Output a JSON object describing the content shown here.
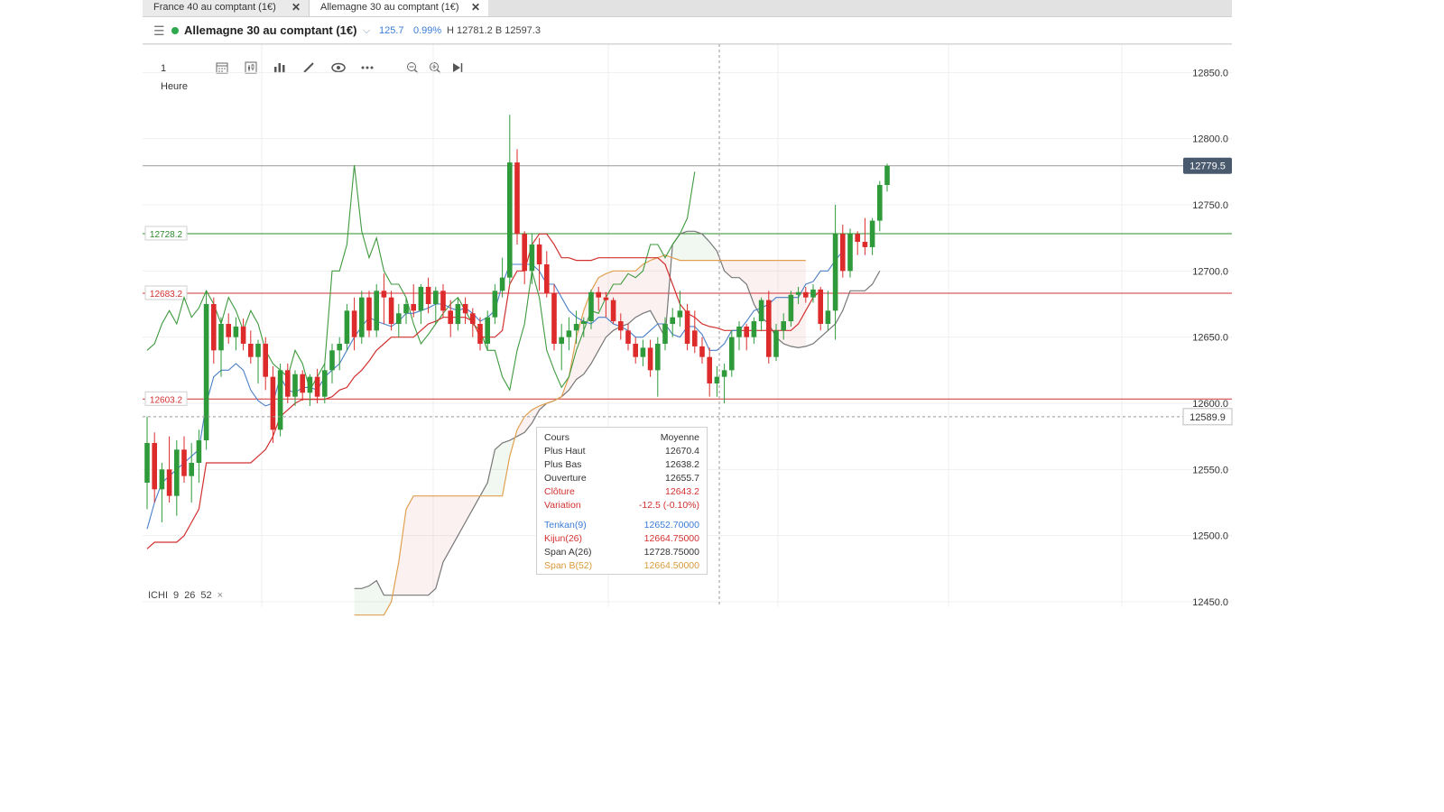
{
  "tabs": [
    {
      "label": "France 40 au comptant (1€)",
      "active": false
    },
    {
      "label": "Allemagne 30 au comptant (1€)",
      "active": true
    }
  ],
  "header": {
    "instrument": "Allemagne 30 au comptant (1€)",
    "change": "125.7",
    "change_pct": "0.99%",
    "high_low": "H 12781.2  B 12597.3",
    "status_color": "#2fa84f"
  },
  "toolbar": {
    "timeframe": "1 Heure",
    "icons": [
      "calendar-icon",
      "chart-type-icon",
      "indicators-icon",
      "draw-icon",
      "eye-icon",
      "more-icon",
      "zoom-out-icon",
      "zoom-in-icon",
      "play-end-icon"
    ]
  },
  "price_axis": {
    "ticks": [
      "12850.0",
      "12800.0",
      "12750.0",
      "12700.0",
      "12650.0",
      "12600.0",
      "12550.0",
      "12500.0",
      "12450.0"
    ],
    "current_price": "12779.5",
    "crosshair_price": "12589.9"
  },
  "levels": [
    {
      "label": "12728.2",
      "color": "#2e8b2e"
    },
    {
      "label": "12683.2",
      "color": "#d23030"
    },
    {
      "label": "12603.2",
      "color": "#d23030"
    }
  ],
  "tooltip": {
    "header_key": "Cours",
    "header_val": "Moyenne",
    "rows": [
      {
        "k": "Plus Haut",
        "v": "12670.4",
        "color": "#333333"
      },
      {
        "k": "Plus Bas",
        "v": "12638.2",
        "color": "#333333"
      },
      {
        "k": "Ouverture",
        "v": "12655.7",
        "color": "#333333"
      },
      {
        "k": "Clôture",
        "v": "12643.2",
        "color": "#d23030"
      },
      {
        "k": "Variation",
        "v": "-12.5 (-0.10%)",
        "color": "#d23030"
      }
    ],
    "ind_rows": [
      {
        "k": "Tenkan(9)",
        "v": "12652.70000",
        "color": "#3b7dd8"
      },
      {
        "k": "Kijun(26)",
        "v": "12664.75000",
        "color": "#d23030"
      },
      {
        "k": "Span A(26)",
        "v": "12728.75000",
        "color": "#333333"
      },
      {
        "k": "Span B(52)",
        "v": "12664.50000",
        "color": "#d99a3a"
      }
    ]
  },
  "indicator_label": {
    "name": "ICHI",
    "p1": "9",
    "p2": "26",
    "p3": "52",
    "close": "×"
  },
  "colors": {
    "up": "#2e9a3a",
    "down": "#dd2a2a",
    "tenkan": "#4a7fc8",
    "kijun": "#d23030",
    "chikou": "#3f9a3f",
    "spanA": "#777777",
    "spanB": "#e0a050"
  },
  "chart_data": {
    "type": "candlestick",
    "title": "Allemagne 30 au comptant (1€)",
    "interval": "1 Heure",
    "ylim": [
      12450,
      12860
    ],
    "grid": true,
    "candles": [
      {
        "o": 12540,
        "h": 12590,
        "l": 12520,
        "c": 12570
      },
      {
        "o": 12570,
        "h": 12578,
        "l": 12525,
        "c": 12535
      },
      {
        "o": 12535,
        "h": 12555,
        "l": 12510,
        "c": 12550
      },
      {
        "o": 12550,
        "h": 12575,
        "l": 12525,
        "c": 12530
      },
      {
        "o": 12530,
        "h": 12572,
        "l": 12515,
        "c": 12565
      },
      {
        "o": 12565,
        "h": 12575,
        "l": 12540,
        "c": 12545
      },
      {
        "o": 12545,
        "h": 12570,
        "l": 12525,
        "c": 12555
      },
      {
        "o": 12555,
        "h": 12580,
        "l": 12540,
        "c": 12572
      },
      {
        "o": 12572,
        "h": 12685,
        "l": 12565,
        "c": 12675
      },
      {
        "o": 12675,
        "h": 12680,
        "l": 12630,
        "c": 12640
      },
      {
        "o": 12640,
        "h": 12665,
        "l": 12620,
        "c": 12660
      },
      {
        "o": 12660,
        "h": 12668,
        "l": 12645,
        "c": 12650
      },
      {
        "o": 12650,
        "h": 12665,
        "l": 12640,
        "c": 12658
      },
      {
        "o": 12658,
        "h": 12664,
        "l": 12640,
        "c": 12645
      },
      {
        "o": 12645,
        "h": 12655,
        "l": 12630,
        "c": 12635
      },
      {
        "o": 12635,
        "h": 12648,
        "l": 12615,
        "c": 12645
      },
      {
        "o": 12645,
        "h": 12650,
        "l": 12610,
        "c": 12620
      },
      {
        "o": 12620,
        "h": 12628,
        "l": 12570,
        "c": 12580
      },
      {
        "o": 12580,
        "h": 12630,
        "l": 12575,
        "c": 12625
      },
      {
        "o": 12625,
        "h": 12630,
        "l": 12600,
        "c": 12605
      },
      {
        "o": 12605,
        "h": 12625,
        "l": 12598,
        "c": 12622
      },
      {
        "o": 12622,
        "h": 12625,
        "l": 12602,
        "c": 12608
      },
      {
        "o": 12608,
        "h": 12622,
        "l": 12598,
        "c": 12620
      },
      {
        "o": 12620,
        "h": 12626,
        "l": 12600,
        "c": 12605
      },
      {
        "o": 12605,
        "h": 12630,
        "l": 12600,
        "c": 12625
      },
      {
        "o": 12625,
        "h": 12645,
        "l": 12615,
        "c": 12640
      },
      {
        "o": 12640,
        "h": 12650,
        "l": 12625,
        "c": 12645
      },
      {
        "o": 12645,
        "h": 12675,
        "l": 12640,
        "c": 12670
      },
      {
        "o": 12670,
        "h": 12680,
        "l": 12640,
        "c": 12650
      },
      {
        "o": 12650,
        "h": 12685,
        "l": 12645,
        "c": 12680
      },
      {
        "o": 12680,
        "h": 12685,
        "l": 12650,
        "c": 12655
      },
      {
        "o": 12655,
        "h": 12690,
        "l": 12650,
        "c": 12685
      },
      {
        "o": 12685,
        "h": 12698,
        "l": 12660,
        "c": 12680
      },
      {
        "o": 12680,
        "h": 12685,
        "l": 12655,
        "c": 12660
      },
      {
        "o": 12660,
        "h": 12675,
        "l": 12650,
        "c": 12668
      },
      {
        "o": 12668,
        "h": 12680,
        "l": 12660,
        "c": 12675
      },
      {
        "o": 12675,
        "h": 12690,
        "l": 12665,
        "c": 12670
      },
      {
        "o": 12670,
        "h": 12690,
        "l": 12660,
        "c": 12688
      },
      {
        "o": 12688,
        "h": 12695,
        "l": 12668,
        "c": 12675
      },
      {
        "o": 12675,
        "h": 12688,
        "l": 12660,
        "c": 12685
      },
      {
        "o": 12685,
        "h": 12690,
        "l": 12665,
        "c": 12670
      },
      {
        "o": 12670,
        "h": 12678,
        "l": 12650,
        "c": 12660
      },
      {
        "o": 12660,
        "h": 12680,
        "l": 12655,
        "c": 12675
      },
      {
        "o": 12675,
        "h": 12680,
        "l": 12660,
        "c": 12668
      },
      {
        "o": 12668,
        "h": 12672,
        "l": 12650,
        "c": 12660
      },
      {
        "o": 12660,
        "h": 12665,
        "l": 12640,
        "c": 12645
      },
      {
        "o": 12645,
        "h": 12670,
        "l": 12640,
        "c": 12665
      },
      {
        "o": 12665,
        "h": 12690,
        "l": 12660,
        "c": 12685
      },
      {
        "o": 12685,
        "h": 12710,
        "l": 12680,
        "c": 12695
      },
      {
        "o": 12695,
        "h": 12818,
        "l": 12690,
        "c": 12782
      },
      {
        "o": 12782,
        "h": 12792,
        "l": 12720,
        "c": 12728
      },
      {
        "o": 12728,
        "h": 12730,
        "l": 12690,
        "c": 12700
      },
      {
        "o": 12700,
        "h": 12728,
        "l": 12690,
        "c": 12720
      },
      {
        "o": 12720,
        "h": 12725,
        "l": 12685,
        "c": 12705
      },
      {
        "o": 12705,
        "h": 12715,
        "l": 12680,
        "c": 12683
      },
      {
        "o": 12683,
        "h": 12690,
        "l": 12640,
        "c": 12645
      },
      {
        "o": 12645,
        "h": 12660,
        "l": 12625,
        "c": 12650
      },
      {
        "o": 12650,
        "h": 12665,
        "l": 12640,
        "c": 12655
      },
      {
        "o": 12655,
        "h": 12670,
        "l": 12645,
        "c": 12660
      },
      {
        "o": 12660,
        "h": 12665,
        "l": 12650,
        "c": 12662
      },
      {
        "o": 12662,
        "h": 12686,
        "l": 12656,
        "c": 12684
      },
      {
        "o": 12684,
        "h": 12688,
        "l": 12670,
        "c": 12680
      },
      {
        "o": 12680,
        "h": 12684,
        "l": 12665,
        "c": 12678
      },
      {
        "o": 12678,
        "h": 12680,
        "l": 12660,
        "c": 12662
      },
      {
        "o": 12662,
        "h": 12668,
        "l": 12648,
        "c": 12655
      },
      {
        "o": 12655,
        "h": 12660,
        "l": 12640,
        "c": 12645
      },
      {
        "o": 12645,
        "h": 12650,
        "l": 12630,
        "c": 12635
      },
      {
        "o": 12635,
        "h": 12648,
        "l": 12628,
        "c": 12642
      },
      {
        "o": 12642,
        "h": 12648,
        "l": 12620,
        "c": 12625
      },
      {
        "o": 12625,
        "h": 12650,
        "l": 12605,
        "c": 12645
      },
      {
        "o": 12645,
        "h": 12665,
        "l": 12640,
        "c": 12660
      },
      {
        "o": 12660,
        "h": 12672,
        "l": 12650,
        "c": 12665
      },
      {
        "o": 12665,
        "h": 12685,
        "l": 12658,
        "c": 12670
      },
      {
        "o": 12670,
        "h": 12675,
        "l": 12640,
        "c": 12645
      },
      {
        "o": 12655,
        "h": 12670,
        "l": 12638,
        "c": 12643
      },
      {
        "o": 12643,
        "h": 12650,
        "l": 12630,
        "c": 12635
      },
      {
        "o": 12635,
        "h": 12642,
        "l": 12605,
        "c": 12615
      },
      {
        "o": 12615,
        "h": 12628,
        "l": 12605,
        "c": 12620
      },
      {
        "o": 12620,
        "h": 12630,
        "l": 12600,
        "c": 12625
      },
      {
        "o": 12625,
        "h": 12655,
        "l": 12620,
        "c": 12650
      },
      {
        "o": 12650,
        "h": 12662,
        "l": 12640,
        "c": 12658
      },
      {
        "o": 12658,
        "h": 12660,
        "l": 12640,
        "c": 12650
      },
      {
        "o": 12650,
        "h": 12665,
        "l": 12645,
        "c": 12662
      },
      {
        "o": 12662,
        "h": 12680,
        "l": 12655,
        "c": 12678
      },
      {
        "o": 12678,
        "h": 12685,
        "l": 12630,
        "c": 12635
      },
      {
        "o": 12635,
        "h": 12660,
        "l": 12632,
        "c": 12655
      },
      {
        "o": 12655,
        "h": 12668,
        "l": 12648,
        "c": 12662
      },
      {
        "o": 12662,
        "h": 12685,
        "l": 12658,
        "c": 12682
      },
      {
        "o": 12682,
        "h": 12688,
        "l": 12675,
        "c": 12684
      },
      {
        "o": 12684,
        "h": 12688,
        "l": 12676,
        "c": 12680
      },
      {
        "o": 12680,
        "h": 12690,
        "l": 12676,
        "c": 12686
      },
      {
        "o": 12686,
        "h": 12688,
        "l": 12655,
        "c": 12660
      },
      {
        "o": 12660,
        "h": 12685,
        "l": 12655,
        "c": 12670
      },
      {
        "o": 12670,
        "h": 12750,
        "l": 12648,
        "c": 12728
      },
      {
        "o": 12728,
        "h": 12735,
        "l": 12695,
        "c": 12700
      },
      {
        "o": 12700,
        "h": 12732,
        "l": 12695,
        "c": 12728
      },
      {
        "o": 12728,
        "h": 12730,
        "l": 12712,
        "c": 12722
      },
      {
        "o": 12722,
        "h": 12740,
        "l": 12712,
        "c": 12718
      },
      {
        "o": 12718,
        "h": 12740,
        "l": 12712,
        "c": 12738
      },
      {
        "o": 12738,
        "h": 12768,
        "l": 12730,
        "c": 12765
      },
      {
        "o": 12765,
        "h": 12781,
        "l": 12760,
        "c": 12779.5
      }
    ],
    "tenkan": [
      12505,
      12525,
      12540,
      12545,
      12550,
      12555,
      12560,
      12565,
      12600,
      12620,
      12625,
      12625,
      12630,
      12625,
      12610,
      12602,
      12598,
      12600,
      12620,
      12610,
      12608,
      12612,
      12612,
      12610,
      12620,
      12625,
      12630,
      12640,
      12650,
      12658,
      12665,
      12662,
      12660,
      12658,
      12662,
      12668,
      12668,
      12670,
      12672,
      12675,
      12675,
      12672,
      12670,
      12672,
      12668,
      12662,
      12665,
      12670,
      12690,
      12705,
      12705,
      12705,
      12705,
      12700,
      12690,
      12690,
      12680,
      12670,
      12665,
      12662,
      12660,
      12665,
      12665,
      12660,
      12658,
      12655,
      12650,
      12650,
      12655,
      12660,
      12660,
      12652,
      12650,
      12658,
      12658,
      12652,
      12640,
      12640,
      12645,
      12655,
      12655,
      12662,
      12670,
      12672,
      12675,
      12680,
      12680,
      12680,
      12680,
      12690,
      12692,
      12700,
      12700,
      12708,
      12715
    ],
    "kijun": [
      12490,
      12495,
      12495,
      12495,
      12495,
      12500,
      12510,
      12520,
      12555,
      12555,
      12555,
      12555,
      12555,
      12555,
      12555,
      12560,
      12565,
      12575,
      12590,
      12595,
      12600,
      12603,
      12603,
      12603,
      12603,
      12605,
      12610,
      12612,
      12620,
      12625,
      12632,
      12640,
      12645,
      12650,
      12650,
      12650,
      12650,
      12655,
      12660,
      12662,
      12665,
      12665,
      12665,
      12665,
      12662,
      12650,
      12650,
      12650,
      12655,
      12690,
      12700,
      12700,
      12720,
      12728,
      12728,
      12720,
      12710,
      12710,
      12708,
      12708,
      12708,
      12710,
      12710,
      12710,
      12710,
      12710,
      12710,
      12710,
      12710,
      12710,
      12705,
      12690,
      12675,
      12668,
      12665,
      12660,
      12658,
      12657,
      12655,
      12655,
      12655,
      12655,
      12655,
      12655,
      12655,
      12655,
      12655,
      12655,
      12660,
      12670,
      12680,
      12685
    ],
    "chikou": [
      12640,
      12645,
      12660,
      12670,
      12660,
      12680,
      12665,
      12672,
      12685,
      12675,
      12660,
      12680,
      12670,
      12655,
      12670,
      12660,
      12640,
      12630,
      12625,
      12620,
      12640,
      12630,
      12610,
      12620,
      12630,
      12700,
      12700,
      12720,
      12780,
      12730,
      12710,
      12725,
      12700,
      12690,
      12690,
      12680,
      12660,
      12645,
      12652,
      12660,
      12668,
      12675,
      12680,
      12670,
      12660,
      12655,
      12640,
      12640,
      12620,
      12610,
      12640,
      12660,
      12700,
      12680,
      12640,
      12625,
      12612,
      12620,
      12640,
      12655,
      12670,
      12668,
      12680,
      12690,
      12690,
      12698,
      12695,
      12700,
      12720,
      12720,
      12710,
      12720,
      12728,
      12740,
      12775
    ],
    "span_a": [
      12460,
      12460,
      12462,
      12466,
      12455,
      12455,
      12455,
      12455,
      12455,
      12455,
      12455,
      12460,
      12480,
      12490,
      12500,
      12510,
      12520,
      12530,
      12540,
      12565,
      12570,
      12572,
      12575,
      12578,
      12585,
      12595,
      12600,
      12602,
      12605,
      12610,
      12618,
      12622,
      12630,
      12640,
      12650,
      12655,
      12658,
      12660,
      12665,
      12668,
      12670,
      12660,
      12650,
      12720,
      12728,
      12730,
      12730,
      12728,
      12722,
      12715,
      12700,
      12695,
      12695,
      12690,
      12675,
      12665,
      12660,
      12650,
      12645,
      12643,
      12642,
      12643,
      12645,
      12650,
      12655,
      12660,
      12670,
      12685,
      12685,
      12685,
      12690,
      12700
    ],
    "span_b": [
      12440,
      12440,
      12440,
      12440,
      12440,
      12450,
      12480,
      12520,
      12530,
      12530,
      12530,
      12530,
      12530,
      12530,
      12530,
      12530,
      12530,
      12530,
      12530,
      12530,
      12530,
      12560,
      12580,
      12590,
      12595,
      12598,
      12600,
      12602,
      12605,
      12620,
      12650,
      12670,
      12685,
      12695,
      12698,
      12700,
      12700,
      12700,
      12700,
      12705,
      12708,
      12710,
      12712,
      12710,
      12708,
      12708,
      12708,
      12708,
      12708,
      12708,
      12708,
      12708,
      12708,
      12708,
      12708,
      12708,
      12708,
      12708,
      12708,
      12708,
      12708,
      12708
    ]
  }
}
